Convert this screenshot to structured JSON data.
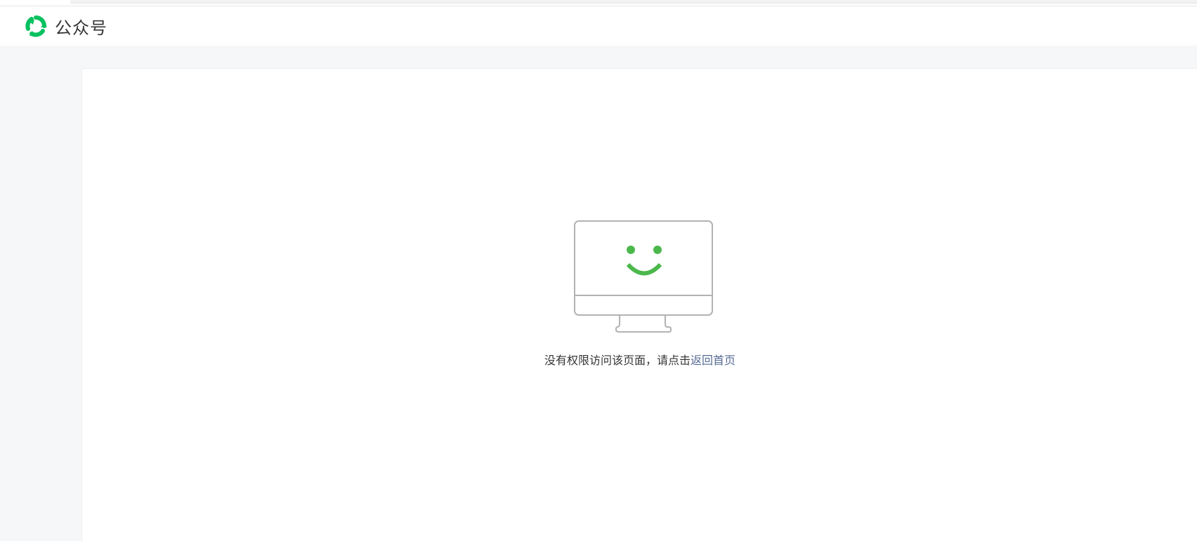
{
  "header": {
    "brand_name": "公众号",
    "logo_icon": "wechat-official-account-logo-icon"
  },
  "empty_state": {
    "illustration_icon": "smiling-monitor-icon",
    "message": "没有权限访问该页面，请点击",
    "link_label": "返回首页"
  },
  "colors": {
    "brand_green": "#07c160",
    "smile_green": "#4cb84c",
    "link_blue": "#576b95",
    "text": "#353535",
    "page_bg": "#f6f7f9"
  }
}
